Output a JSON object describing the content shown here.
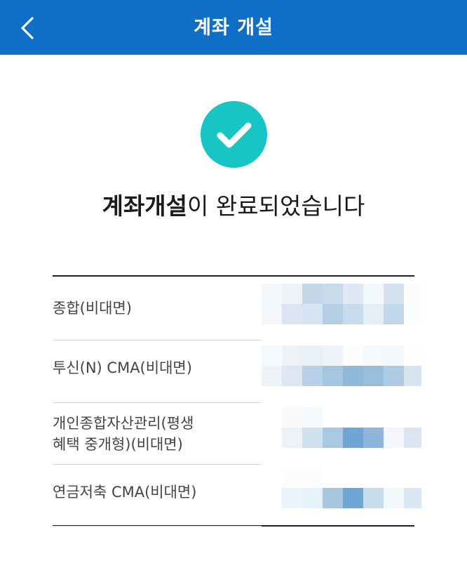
{
  "header": {
    "title": "계좌 개설",
    "back_icon": "chevron-left-icon"
  },
  "status": {
    "icon": "check-circle-icon",
    "icon_color": "#17c5c4",
    "message_bold": "계좌개설",
    "message_rest": "이 완료되었습니다"
  },
  "accounts": [
    {
      "label": "종합(비대면)",
      "number": "(blurred)"
    },
    {
      "label": "투신(N) CMA(비대면)",
      "number": "(blurred)"
    },
    {
      "label": "개인종합자산관리(평생\n혜택 중개형)(비대면)",
      "number": "(blurred)"
    },
    {
      "label": "연금저축 CMA(비대면)",
      "number": "(blurred)"
    }
  ],
  "colors": {
    "header_bg": "#0f6fc6",
    "accent": "#17c5c4"
  }
}
